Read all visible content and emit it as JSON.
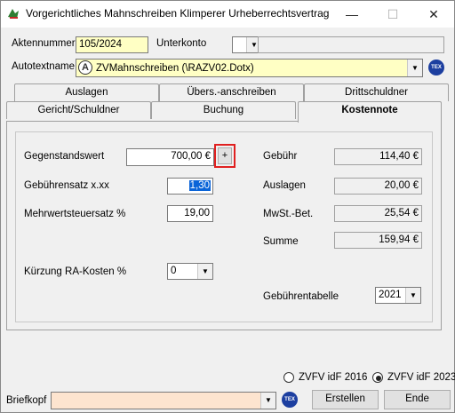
{
  "window": {
    "title": "Vorgerichtliches Mahnschreiben Klimperer Urheberrechtsvertrag",
    "minimize_glyph": "—",
    "maximize_glyph": "☐",
    "close_glyph": "✕"
  },
  "header": {
    "aktennummer_label": "Aktennummer",
    "aktennummer_value": "105/2024",
    "unterkonto_label": "Unterkonto",
    "unterkonto_value": "",
    "right_field_value": "",
    "autotextname_label": "Autotextname",
    "autotextname_value": "ZVMahnschreiben (\\RAZV02.Dotx)",
    "tex_icon_text": "TEX"
  },
  "tabs": {
    "row1": [
      "Auslagen",
      "Übers.-anschreiben",
      "Drittschuldner"
    ],
    "row2": [
      "Gericht/Schuldner",
      "Buchung",
      "Kostennote"
    ],
    "active": "Kostennote"
  },
  "kostennote": {
    "gegenstandswert_label": "Gegenstandswert",
    "gegenstandswert_value": "700,00 €",
    "plus_button": "+",
    "gebuehrensatz_label": "Gebührensatz x.xx",
    "gebuehrensatz_value": "1,30",
    "mwst_satz_label": "Mehrwertsteuersatz %",
    "mwst_satz_value": "19,00",
    "kuerzung_label": "Kürzung RA-Kosten %",
    "kuerzung_value": "0",
    "gebuehr_label": "Gebühr",
    "gebuehr_value": "114,40 €",
    "auslagen_label": "Auslagen",
    "auslagen_value": "20,00 €",
    "mwst_bet_label": "MwSt.-Bet.",
    "mwst_bet_value": "25,54 €",
    "summe_label": "Summe",
    "summe_value": "159,94 €",
    "gebuehrentabelle_label": "Gebührentabelle",
    "gebuehrentabelle_value": "2021"
  },
  "footer": {
    "radio1_label": "ZVFV idF 2016",
    "radio2_label": "ZVFV idF 2023",
    "radio_selected": "ZVFV idF 2023",
    "briefkopf_label": "Briefkopf",
    "briefkopf_value": "",
    "erstellen_label": "Erstellen",
    "ende_label": "Ende"
  },
  "colors": {
    "highlight_box": "#e02020",
    "yellow_field": "#ffffc4",
    "orange_field": "#fde4cf",
    "selection": "#0a64d8"
  }
}
